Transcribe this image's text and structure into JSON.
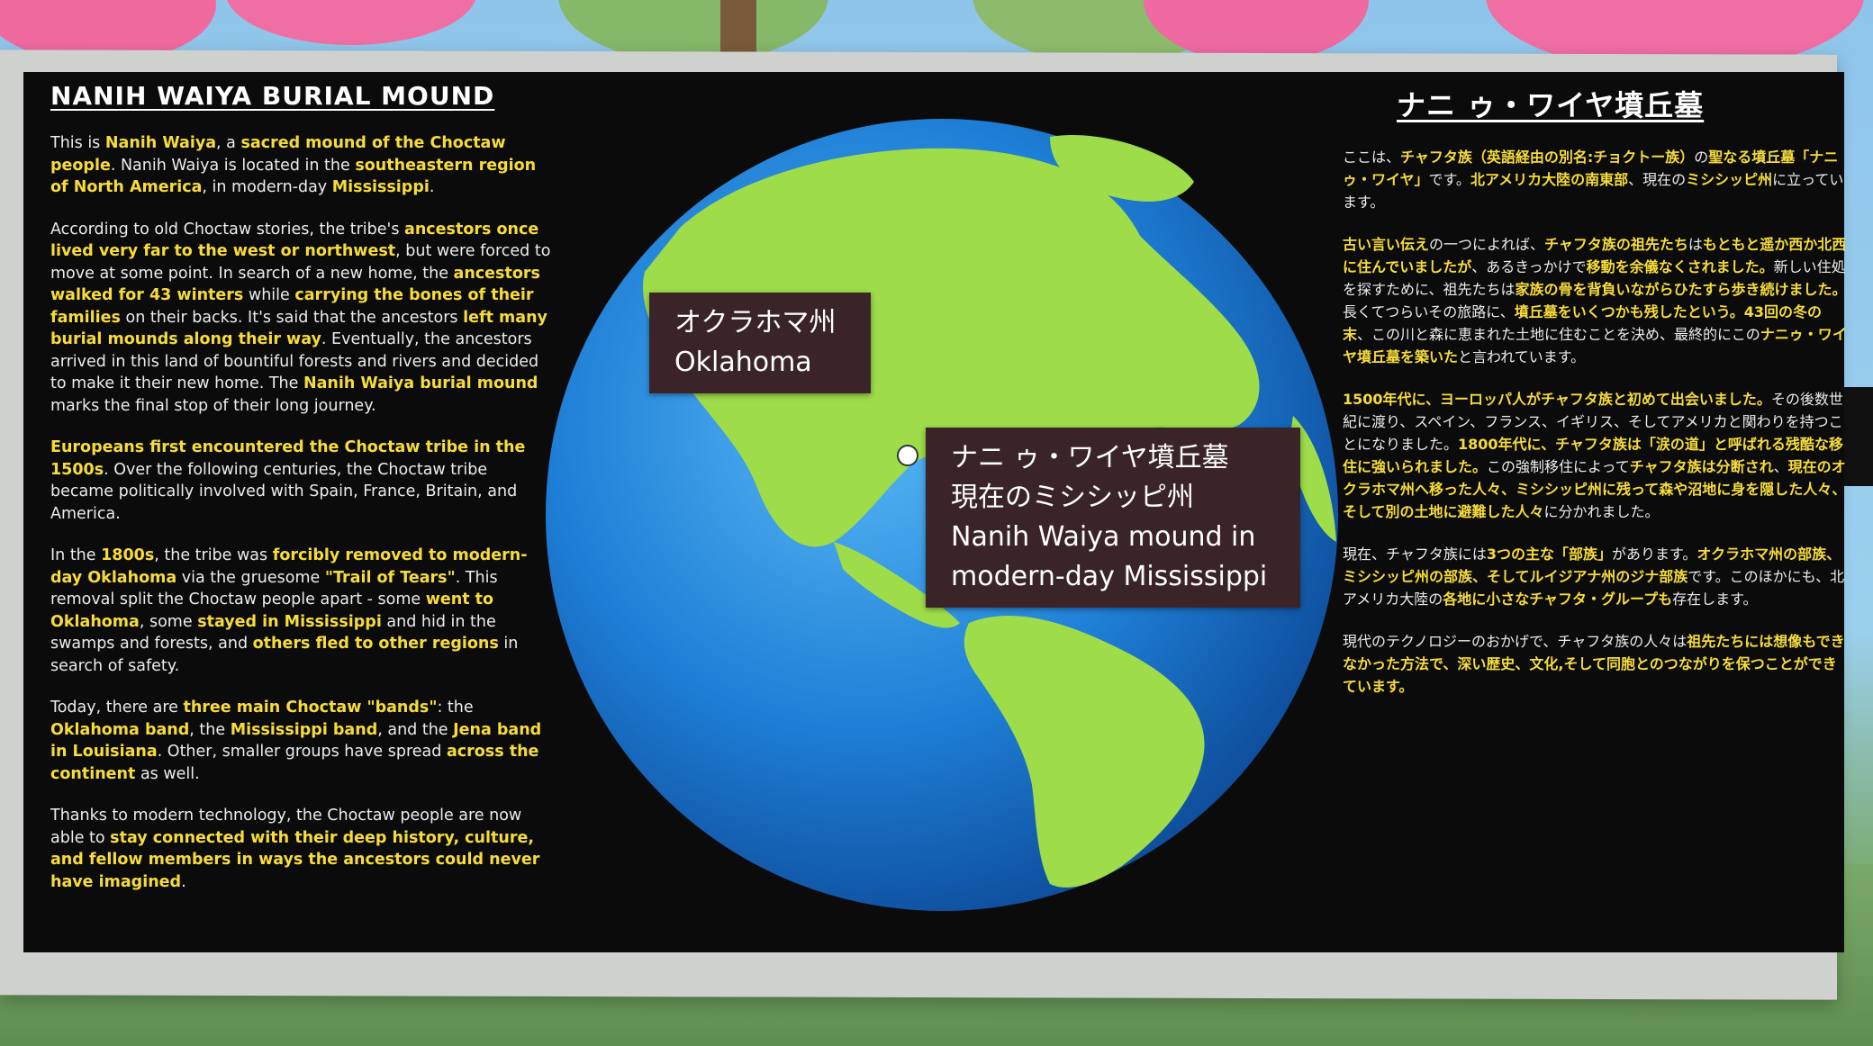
{
  "colors": {
    "highlight": "#f6dc3a",
    "body_text": "#ececec",
    "label_bg": "#3a2427",
    "ocean": "#1e7fd6",
    "land": "#9edc4a",
    "marker_oklahoma": "#ffffff",
    "marker_mound": "#e8451c"
  },
  "left_panel": {
    "title": "NANIH WAIYA BURIAL MOUND",
    "paragraphs": [
      [
        {
          "t": "This is "
        },
        {
          "t": "Nanih Waiya",
          "h": true
        },
        {
          "t": ", a "
        },
        {
          "t": "sacred mound of the Choctaw people",
          "h": true
        },
        {
          "t": ". Nanih Waiya is located in the "
        },
        {
          "t": "southeastern region of North America",
          "h": true
        },
        {
          "t": ", in modern-day "
        },
        {
          "t": "Mississippi",
          "h": true
        },
        {
          "t": "."
        }
      ],
      [
        {
          "t": "According to old Choctaw stories, the tribe's "
        },
        {
          "t": "ancestors once lived very far to the west or northwest",
          "h": true
        },
        {
          "t": ", but were forced to move at some point. In search of a new home, the "
        },
        {
          "t": "ancestors walked for 43 winters",
          "h": true
        },
        {
          "t": " while "
        },
        {
          "t": "carrying the bones of their families",
          "h": true
        },
        {
          "t": " on their backs. It's said that the ancestors "
        },
        {
          "t": "left many burial mounds along their way",
          "h": true
        },
        {
          "t": ". Eventually, the ancestors arrived in this land of bountiful forests and rivers and decided to make it their new home. The "
        },
        {
          "t": "Nanih Waiya burial mound",
          "h": true
        },
        {
          "t": " marks the final stop of their long journey."
        }
      ],
      [
        {
          "t": "Europeans first encountered the Choctaw tribe in the 1500s",
          "h": true
        },
        {
          "t": ". Over the following centuries, the Choctaw tribe became politically involved with Spain, France, Britain, and America."
        }
      ],
      [
        {
          "t": "In the "
        },
        {
          "t": "1800s",
          "h": true
        },
        {
          "t": ", the tribe was "
        },
        {
          "t": "forcibly removed to modern-day Oklahoma",
          "h": true
        },
        {
          "t": " via the gruesome "
        },
        {
          "t": "\"Trail of Tears\"",
          "h": true
        },
        {
          "t": ". This removal split the Choctaw people apart - some "
        },
        {
          "t": "went to Oklahoma",
          "h": true
        },
        {
          "t": ", some "
        },
        {
          "t": "stayed in Mississippi",
          "h": true
        },
        {
          "t": " and hid in the swamps and forests, and "
        },
        {
          "t": "others fled to other regions",
          "h": true
        },
        {
          "t": " in search of safety."
        }
      ],
      [
        {
          "t": "Today, there are "
        },
        {
          "t": "three main Choctaw \"bands\"",
          "h": true
        },
        {
          "t": ": the "
        },
        {
          "t": "Oklahoma band",
          "h": true
        },
        {
          "t": ", the "
        },
        {
          "t": "Mississippi band",
          "h": true
        },
        {
          "t": ", and the "
        },
        {
          "t": "Jena band in Louisiana",
          "h": true
        },
        {
          "t": ". Other, smaller groups have spread "
        },
        {
          "t": "across the continent",
          "h": true
        },
        {
          "t": " as well."
        }
      ],
      [
        {
          "t": "Thanks to modern technology, the Choctaw people are now able to "
        },
        {
          "t": "stay connected with their deep history, culture, and fellow members in ways the ancestors could never have imagined",
          "h": true
        },
        {
          "t": "."
        }
      ]
    ]
  },
  "right_panel": {
    "title": "ナニ ゥ・ワイヤ墳丘墓",
    "paragraphs": [
      [
        {
          "t": "ここは、"
        },
        {
          "t": "チャフタ族（英語経由の別名:チョクトー族）",
          "h": true
        },
        {
          "t": "の"
        },
        {
          "t": "聖なる墳丘墓「ナニゥ・ワイヤ」",
          "h": true
        },
        {
          "t": "です。"
        },
        {
          "t": "北アメリカ大陸の南東部",
          "h": true
        },
        {
          "t": "、現在の"
        },
        {
          "t": "ミシシッピ州",
          "h": true
        },
        {
          "t": "に立っています。"
        }
      ],
      [
        {
          "t": "古い言い伝え",
          "h": true
        },
        {
          "t": "の一つによれば、"
        },
        {
          "t": "チャフタ族の祖先たち",
          "h": true
        },
        {
          "t": "は"
        },
        {
          "t": "もともと遥か西か北西に住んでいましたが",
          "h": true
        },
        {
          "t": "、あるきっかけで"
        },
        {
          "t": "移動を余儀なくされました。",
          "h": true
        },
        {
          "t": "新しい住処を探すために、祖先たちは"
        },
        {
          "t": "家族の骨を背負いながらひたすら歩き続けました。",
          "h": true
        },
        {
          "t": "長くてつらいその旅路に、"
        },
        {
          "t": "墳丘墓をいくつかも残したという。",
          "h": true
        },
        {
          "t": "43回の冬の末",
          "h": true
        },
        {
          "t": "、この川と森に恵まれた土地に住むことを決め、最終的にこの"
        },
        {
          "t": "ナニゥ・ワイヤ墳丘墓を築いた",
          "h": true
        },
        {
          "t": "と言われています。"
        }
      ],
      [
        {
          "t": "1500年代に、ヨーロッパ人がチャフタ族と初めて出会いました。",
          "h": true
        },
        {
          "t": "その後数世紀に渡り、スペイン、フランス、イギリス、そしてアメリカと関わりを持つことになりました。"
        },
        {
          "t": "1800年代に、チャフタ族は「涙の道」と呼ばれる残酷な移住に強いられました。",
          "h": true
        },
        {
          "t": "この強制移住によって"
        },
        {
          "t": "チャフタ族は分断され",
          "h": true
        },
        {
          "t": "、"
        },
        {
          "t": "現在のオクラホマ州へ移った人々、ミシシッピ州に残って森や沼地に身を隠した人々、そして別の土地に避難した人々",
          "h": true
        },
        {
          "t": "に分かれました。"
        }
      ],
      [
        {
          "t": "現在、チャフタ族には"
        },
        {
          "t": "3つの主な「部族」",
          "h": true
        },
        {
          "t": "があります。"
        },
        {
          "t": "オクラホマ州の部族、ミシシッピ州の部族、そしてルイジアナ州のジナ部族",
          "h": true
        },
        {
          "t": "です。このほかにも、北アメリカ大陸の"
        },
        {
          "t": "各地に小さなチャフタ・グループも",
          "h": true
        },
        {
          "t": "存在します。"
        }
      ],
      [
        {
          "t": "現代のテクノロジーのおかげで、チャフタ族の人々は"
        },
        {
          "t": "祖先たちには想像もできなかった方法で、深い歴史、文化,そして同胞とのつながりを保つことができています。",
          "h": true
        }
      ]
    ]
  },
  "globe_labels": {
    "oklahoma": [
      "オクラホマ州",
      "Oklahoma"
    ],
    "mound": [
      "ナニ ゥ・ワイヤ墳丘墓",
      "現在のミシシッピ州",
      "Nanih Waiya mound in",
      "modern-day Mississippi"
    ]
  }
}
